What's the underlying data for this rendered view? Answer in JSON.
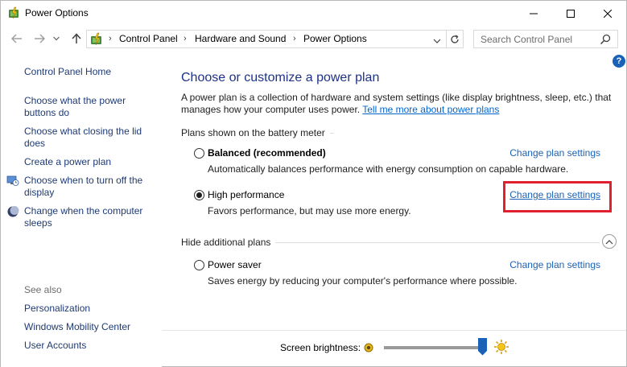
{
  "window": {
    "title": "Power Options"
  },
  "address": {
    "crumbs": [
      "Control Panel",
      "Hardware and Sound",
      "Power Options"
    ]
  },
  "search": {
    "placeholder": "Search Control Panel"
  },
  "help": {
    "glyph": "?"
  },
  "sidebar": {
    "home": "Control Panel Home",
    "items": [
      {
        "label": "Choose what the power buttons do",
        "icon": null
      },
      {
        "label": "Choose what closing the lid does",
        "icon": null
      },
      {
        "label": "Create a power plan",
        "icon": null
      },
      {
        "label": "Choose when to turn off the display",
        "icon": "monitor-clock-icon"
      },
      {
        "label": "Change when the computer sleeps",
        "icon": "moon-icon"
      }
    ],
    "see_also_label": "See also",
    "see_also": [
      "Personalization",
      "Windows Mobility Center",
      "User Accounts"
    ]
  },
  "main": {
    "title": "Choose or customize a power plan",
    "description": "A power plan is a collection of hardware and system settings (like display brightness, sleep, etc.) that manages how your computer uses power.",
    "learn_more_link": "Tell me more about power plans",
    "group_battery_label": "Plans shown on the battery meter",
    "group_hidden_label": "Hide additional plans",
    "plans": [
      {
        "name": "Balanced (recommended)",
        "description": "Automatically balances performance with energy consumption on capable hardware.",
        "link": "Change plan settings",
        "selected": false
      },
      {
        "name": "High performance",
        "description": "Favors performance, but may use more energy.",
        "link": "Change plan settings",
        "selected": true
      },
      {
        "name": "Power saver",
        "description": "Saves energy by reducing your computer's performance where possible.",
        "link": "Change plan settings",
        "selected": false
      }
    ]
  },
  "brightness": {
    "label": "Screen brightness:",
    "level_percent": 100
  },
  "colors": {
    "link": "#1a62b7",
    "title": "#1e3287",
    "highlight": "#e0202e",
    "slider_thumb": "#1a62b7"
  }
}
